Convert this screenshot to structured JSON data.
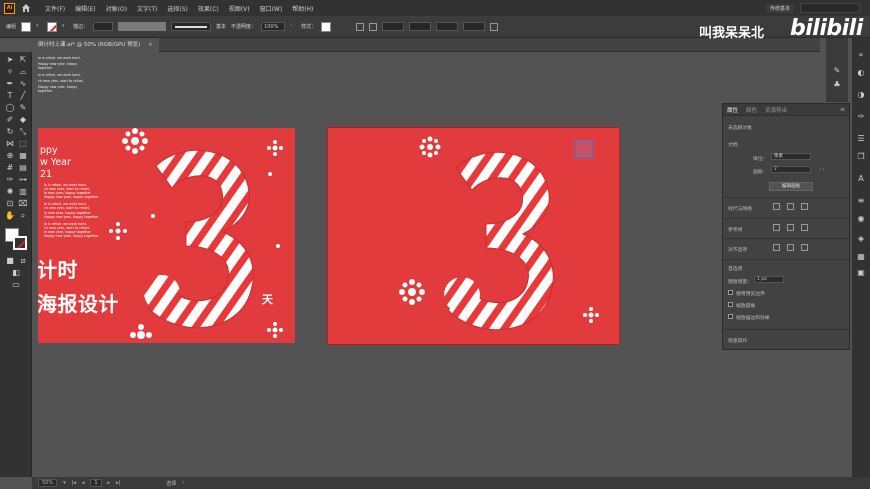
{
  "app": {
    "logo": "Ai",
    "menu": [
      "文件(F)",
      "编辑(E)",
      "对象(O)",
      "文字(T)",
      "选择(S)",
      "效果(C)",
      "视图(V)",
      "窗口(W)",
      "帮助(H)"
    ],
    "workspace": "传统基本"
  },
  "controlbar": {
    "label": "编组",
    "stroke_label": "描边：",
    "stroke_style": "基本",
    "opacity_label": "不透明度：",
    "opacity_value": "100%",
    "style_label": "样式："
  },
  "tab": {
    "title": "倒计时上课.ai* @ 50% (RGB/GPU 预览)",
    "close": "×"
  },
  "artboard1": {
    "happy_lines": [
      "ppy",
      "w Year",
      "21"
    ],
    "small_lines": [
      "lo is refuel, we work hard,",
      "ch new year, start to refuel,",
      "lo new year, happy together",
      "Happy new year, happy together"
    ],
    "title_line1": "计时",
    "title_line2": "海报设计",
    "tian": "天"
  },
  "canvas_text": {
    "lines": [
      "lo is refuel, we work hard,",
      "ch new year, start to refuel,",
      "lo new year, happy together",
      "Happy new year, happy together"
    ]
  },
  "watermark": {
    "text": "叫我呆呆北",
    "logo": "bilibili"
  },
  "panel": {
    "tabs": [
      "属性",
      "颜色",
      "资源导出"
    ],
    "menu": "≡",
    "no_selection": "未选择对象",
    "document": "文档",
    "unit_label": "单位：",
    "unit_value": "像素",
    "artboard_label": "画板：",
    "artboard_value": "2",
    "edit_artboard": "编辑画板",
    "ruler_grid": "标尺与网格",
    "guides": "参考线",
    "snap": "对齐选项",
    "prefs": "首选项",
    "keyboard_inc_label": "键盘增量：",
    "keyboard_inc_value": "1 px",
    "checks": [
      "使用预览边界",
      "缩放圆角",
      "缩放描边和效果"
    ],
    "quick_actions": "快速操作"
  },
  "status": {
    "zoom": "50%",
    "artboard": "1",
    "tool": "选择"
  },
  "colors": {
    "artboard_red": "#e23b3d",
    "ui_dark": "#323232",
    "canvas_gray": "#535353"
  }
}
